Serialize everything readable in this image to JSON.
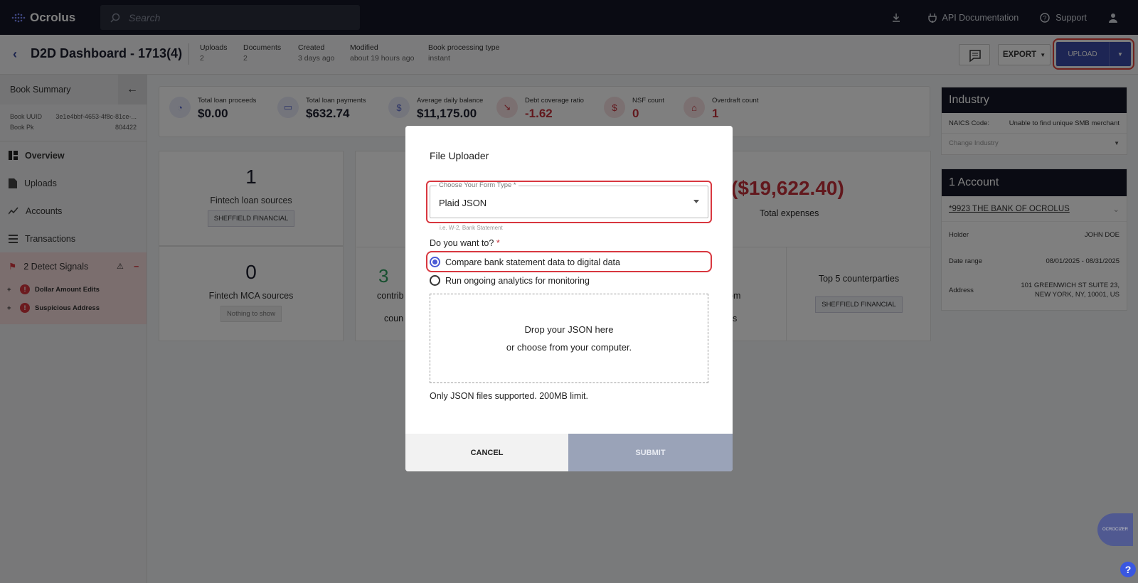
{
  "app": {
    "brand": "Ocrolus"
  },
  "topbar": {
    "search_placeholder": "Search",
    "api_docs": "API Documentation",
    "support": "Support"
  },
  "header": {
    "title": "D2D Dashboard - 1713(4)",
    "meta": [
      {
        "label": "Uploads",
        "value": "2"
      },
      {
        "label": "Documents",
        "value": "2"
      },
      {
        "label": "Created",
        "value": "3 days ago"
      },
      {
        "label": "Modified",
        "value": "about 19 hours ago"
      },
      {
        "label": "Book processing type",
        "value": "instant"
      }
    ],
    "export_label": "EXPORT",
    "upload_label": "UPLOAD"
  },
  "sidebar": {
    "head": "Book Summary",
    "uuid_label": "Book UUID",
    "uuid_value": "3e1e4bbf-4653-4f8c-81ce-...",
    "pk_label": "Book Pk",
    "pk_value": "804422",
    "nav": [
      "Overview",
      "Uploads",
      "Accounts",
      "Transactions"
    ],
    "signals_title": "2 Detect Signals",
    "signals": [
      "Dollar Amount Edits",
      "Suspicious Address"
    ]
  },
  "stats": [
    {
      "label": "Total loan proceeds",
      "value": "$0.00"
    },
    {
      "label": "Total loan payments",
      "value": "$632.74"
    },
    {
      "label": "Average daily balance",
      "value": "$11,175.00"
    },
    {
      "label": "Debt coverage ratio",
      "value": "-1.62"
    },
    {
      "label": "NSF count",
      "value": "0"
    },
    {
      "label": "Overdraft count",
      "value": "1"
    }
  ],
  "cards": {
    "fintech_loan_num": "1",
    "fintech_loan_label": "Fintech loan sources",
    "fintech_loan_chip": "SHEFFIELD FINANCIAL",
    "mca_num": "0",
    "mca_label": "Fintech MCA sources",
    "mca_chip": "Nothing to show",
    "partial_num": "3",
    "partial_l1": "contrib",
    "partial_l2": "coun",
    "expenses_value": "($19,622.40)",
    "expenses_label": "Total expenses",
    "partial_om": "om",
    "partial_s": "s",
    "top5_label": "Top 5 counterparties",
    "top5_chip": "SHEFFIELD FINANCIAL"
  },
  "industry": {
    "title": "Industry",
    "naics_label": "NAICS Code:",
    "naics_value": "Unable to find unique SMB merchant",
    "change_placeholder": "Change Industry"
  },
  "account": {
    "title": "1 Account",
    "name": "*9923 THE BANK OF OCROLUS",
    "holder_label": "Holder",
    "holder_value": "JOHN DOE",
    "range_label": "Date range",
    "range_value": "08/01/2025 - 08/31/2025",
    "address_label": "Address",
    "address_value": "101 GREENWICH ST SUITE 23, NEW YORK, NY, 10001, US"
  },
  "modal": {
    "title": "File Uploader",
    "select_label": "Choose Your Form Type *",
    "select_value": "Plaid JSON",
    "select_helper": "i.e. W-2, Bank Statement",
    "question": "Do you want to?",
    "option1": "Compare bank statement data to digital data",
    "option2": "Run ongoing analytics for monitoring",
    "drop_line1": "Drop your JSON here",
    "drop_line2": "or choose from your computer.",
    "note": "Only JSON files supported. 200MB limit.",
    "cancel": "CANCEL",
    "submit": "SUBMIT"
  },
  "widget": {
    "ocro": "OCROCIZER",
    "help": "?"
  }
}
